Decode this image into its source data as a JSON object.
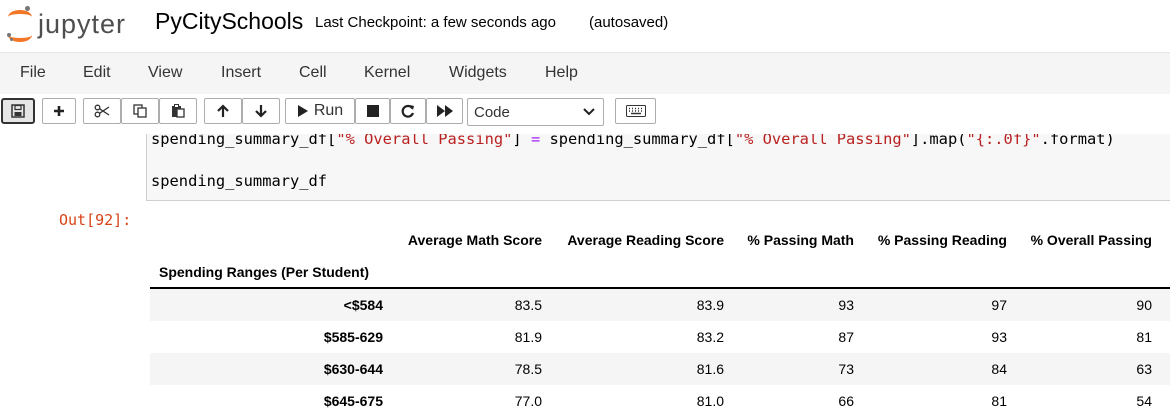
{
  "header": {
    "logo_text": "jupyter",
    "notebook_title": "PyCitySchools",
    "checkpoint": "Last Checkpoint: a few seconds ago",
    "autosave": "(autosaved)",
    "accent": "#f37726"
  },
  "menubar": {
    "items": [
      "File",
      "Edit",
      "View",
      "Insert",
      "Cell",
      "Kernel",
      "Widgets",
      "Help"
    ]
  },
  "toolbar": {
    "save_icon": "floppy-disk-icon",
    "add_icon": "plus-icon",
    "cut_icon": "scissors-icon",
    "copy_icon": "copy-icon",
    "paste_icon": "paste-icon",
    "move_up_icon": "arrow-up-icon",
    "move_down_icon": "arrow-down-icon",
    "run_label": "Run",
    "stop_icon": "stop-icon",
    "restart_icon": "restart-icon",
    "fast_forward_icon": "fast-forward-icon",
    "cell_type": "Code",
    "keyboard_icon": "keyboard-icon"
  },
  "cell": {
    "code_lines": [
      "spending_summary_df[\"% Overall Passing\"] = spending_summary_df[\"% Overall Passing\"].map(\"{:.0f}\".format)",
      "spending_summary_df"
    ],
    "out_prompt": "Out[92]:"
  },
  "dataframe": {
    "columns": [
      "Average Math Score",
      "Average Reading Score",
      "% Passing Math",
      "% Passing Reading",
      "% Overall Passing"
    ],
    "index_name": "Spending Ranges (Per Student)",
    "rows": [
      {
        "index": "<$584",
        "values": [
          "83.5",
          "83.9",
          "93",
          "97",
          "90"
        ]
      },
      {
        "index": "$585-629",
        "values": [
          "81.9",
          "83.2",
          "87",
          "93",
          "81"
        ]
      },
      {
        "index": "$630-644",
        "values": [
          "78.5",
          "81.6",
          "73",
          "84",
          "63"
        ]
      },
      {
        "index": "$645-675",
        "values": [
          "77.0",
          "81.0",
          "66",
          "81",
          "54"
        ]
      }
    ]
  }
}
